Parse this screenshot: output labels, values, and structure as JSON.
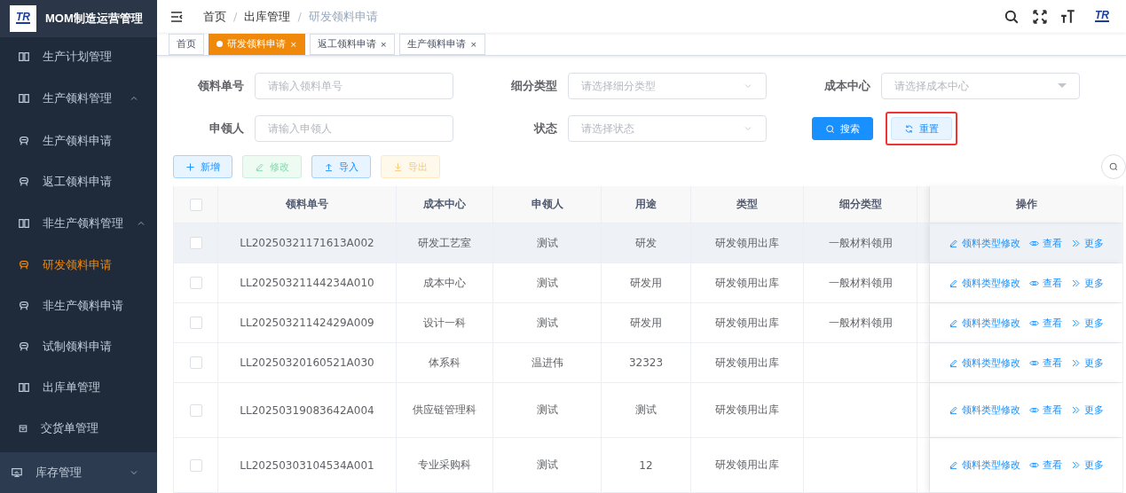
{
  "sidebar": {
    "logo": {
      "mark": "TR"
    },
    "title": "MOM制造运营管理",
    "items": [
      {
        "label": "生产计划管理",
        "kind": "book",
        "selected": false
      },
      {
        "label": "生产领料管理",
        "kind": "group",
        "expanded": true,
        "selected": false,
        "children": [
          {
            "label": "生产领料申请",
            "kind": "robot",
            "selected": false
          },
          {
            "label": "返工领料申请",
            "kind": "robot",
            "selected": false
          }
        ]
      },
      {
        "label": "非生产领料管理",
        "kind": "group",
        "expanded": true,
        "selected": false,
        "children": [
          {
            "label": "研发领料申请",
            "kind": "robot",
            "selected": true
          },
          {
            "label": "非生产领料申请",
            "kind": "robot",
            "selected": false
          },
          {
            "label": "试制领料申请",
            "kind": "robot",
            "selected": false
          }
        ]
      },
      {
        "label": "出库单管理",
        "kind": "book",
        "selected": false
      },
      {
        "label": "交货单管理",
        "kind": "calendar",
        "selected": false
      }
    ],
    "sections": [
      {
        "label": "库存管理",
        "expanded": false
      }
    ]
  },
  "header": {
    "breadcrumb": [
      "首页",
      "出库管理",
      "研发领料申请"
    ],
    "separator": "/",
    "logo": {
      "mark": "TR"
    }
  },
  "tabs": [
    {
      "label": "首页",
      "selected": false,
      "closable": false
    },
    {
      "label": "研发领料申请",
      "selected": true,
      "closable": true,
      "close": "×"
    },
    {
      "label": "返工领料申请",
      "selected": false,
      "closable": true,
      "close": "×"
    },
    {
      "label": "生产领料申请",
      "selected": false,
      "closable": true,
      "close": "×"
    }
  ],
  "filters": [
    {
      "label": "领料单号",
      "kind": "input",
      "placeholder": "请输入领料单号"
    },
    {
      "label": "细分类型",
      "kind": "select",
      "placeholder": "请选择细分类型"
    },
    {
      "label": "成本中心",
      "kind": "dropdown",
      "placeholder": "请选择成本中心"
    },
    {
      "label": "申领人",
      "kind": "input",
      "placeholder": "请输入申领人"
    },
    {
      "label": "状态",
      "kind": "select",
      "placeholder": "请选择状态"
    }
  ],
  "search_buttons": [
    {
      "label": "搜索",
      "kind": "primary",
      "highlighted": false
    },
    {
      "label": "重置",
      "kind": "reset",
      "highlighted": true
    }
  ],
  "toolbar": [
    {
      "label": "新增",
      "kind": "add",
      "disabled": false
    },
    {
      "label": "修改",
      "kind": "edit",
      "disabled": true
    },
    {
      "label": "导入",
      "kind": "import",
      "disabled": false
    },
    {
      "label": "导出",
      "kind": "export",
      "disabled": true
    }
  ],
  "table": {
    "header_checked": false,
    "columns": [
      "领料单号",
      "成本中心",
      "申领人",
      "用途",
      "类型",
      "细分类型",
      "操作"
    ],
    "rows": [
      {
        "checked": false,
        "highlighted": true,
        "tall": false,
        "cells": [
          "LL20250321171613A002",
          "研发工艺室",
          "测试",
          "研发",
          "研发领用出库",
          "一般材料领用"
        ],
        "actions": [
          "领料类型修改",
          "查看",
          "更多"
        ]
      },
      {
        "checked": false,
        "highlighted": false,
        "tall": false,
        "cells": [
          "LL20250321144234A010",
          "成本中心",
          "测试",
          "研发用",
          "研发领用出库",
          "一般材料领用"
        ],
        "actions": [
          "领料类型修改",
          "查看",
          "更多"
        ]
      },
      {
        "checked": false,
        "highlighted": false,
        "tall": false,
        "cells": [
          "LL20250321142429A009",
          "设计一科",
          "测试",
          "研发用",
          "研发领用出库",
          "一般材料领用"
        ],
        "actions": [
          "领料类型修改",
          "查看",
          "更多"
        ]
      },
      {
        "checked": false,
        "highlighted": false,
        "tall": false,
        "cells": [
          "LL20250320160521A030",
          "体系科",
          "温进伟",
          "32323",
          "研发领用出库",
          ""
        ],
        "actions": [
          "领料类型修改",
          "查看",
          "更多"
        ]
      },
      {
        "checked": false,
        "highlighted": false,
        "tall": true,
        "cells": [
          "LL20250319083642A004",
          "供应链管理科",
          "测试",
          "测试",
          "研发领用出库",
          ""
        ],
        "actions": [
          "领料类型修改",
          "查看",
          "更多"
        ]
      },
      {
        "checked": false,
        "highlighted": false,
        "tall": true,
        "cells": [
          "LL20250303104534A001",
          "专业采购科",
          "测试",
          "12",
          "研发领用出库",
          ""
        ],
        "actions": [
          "领料类型修改",
          "查看",
          "更多"
        ]
      }
    ]
  }
}
